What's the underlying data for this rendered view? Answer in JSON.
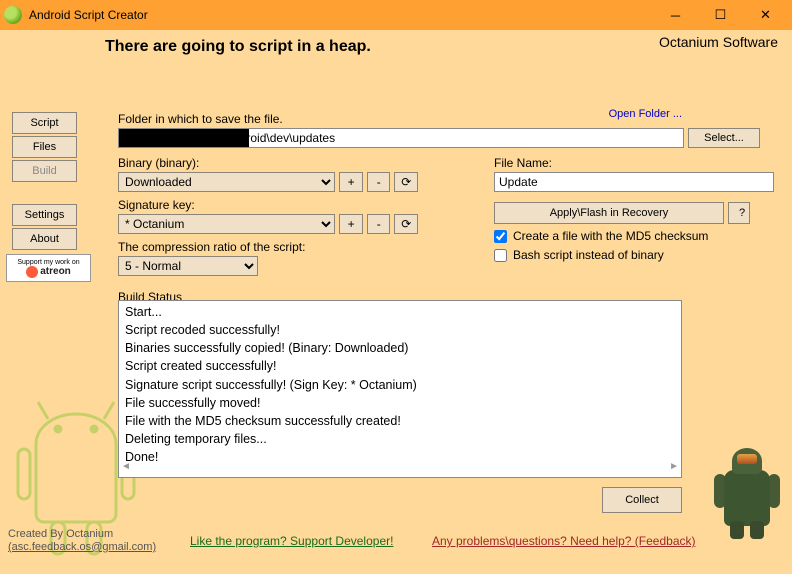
{
  "window": {
    "title": "Android Script Creator"
  },
  "headline": "There are going to script in a heap.",
  "brand": "Octanium Software",
  "sidebar": {
    "script": "Script",
    "files": "Files",
    "build": "Build",
    "settings": "Settings",
    "about": "About"
  },
  "patreon": {
    "line1": "Support my work on",
    "brand": "atreon"
  },
  "form": {
    "folder_label": "Folder in which to save the file.",
    "open_folder": "Open Folder ...",
    "path": "                              \\android\\dev\\updates",
    "select_btn": "Select...",
    "binary_label": "Binary (binary):",
    "binary_value": "Downloaded",
    "sigkey_label": "Signature key:",
    "sigkey_value": "* Octanium",
    "comp_label": "The compression ratio of the script:",
    "comp_value": "5 - Normal",
    "filename_label": "File Name:",
    "filename_value": "Update",
    "apply_btn": "Apply\\Flash in Recovery",
    "help_btn": "?",
    "chk_md5": "Create a file with the MD5 checksum",
    "chk_bash": "Bash script instead of binary",
    "status_label": "Build Status",
    "collect_btn": "Collect",
    "plus": "+",
    "minus": "-",
    "refresh": "⟳"
  },
  "status": [
    "Start...",
    "Script recoded successfully!",
    "Binaries successfully copied! (Binary: Downloaded)",
    "Script created successfully!",
    "Signature script successfully! (Sign Key: * Octanium)",
    "File successfully moved!",
    "File with the MD5 checksum successfully created!",
    "Deleting temporary files...",
    "Done!"
  ],
  "footer": {
    "credit1": "Created By Octanium",
    "credit2": "(asc.feedback.os@gmail.com)",
    "like": "Like the program? Support Developer!",
    "feedback": "Any problems\\questions? Need help? (Feedback)"
  }
}
